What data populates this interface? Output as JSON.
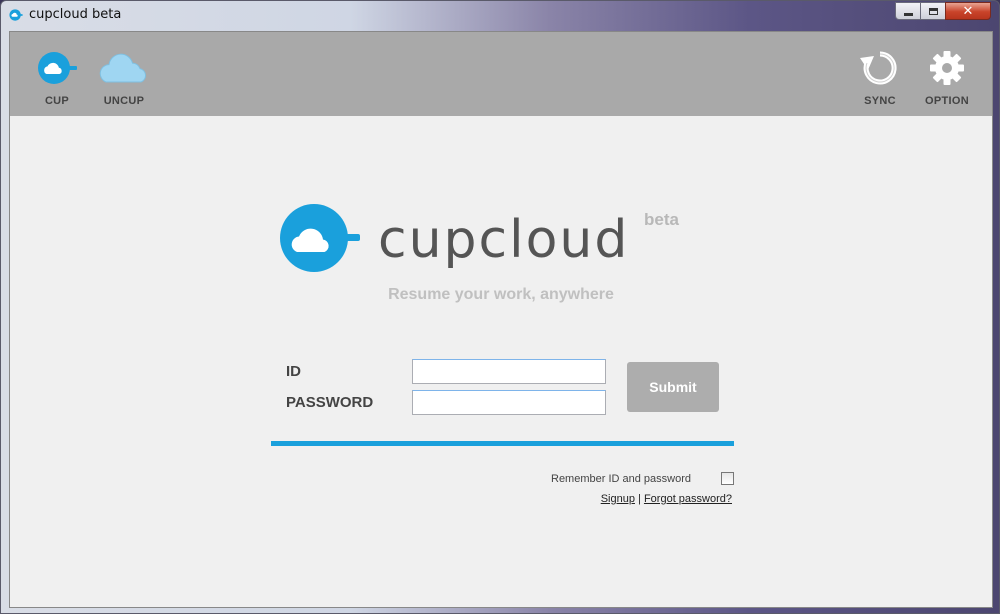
{
  "window": {
    "title": "cupcloud beta",
    "controls": {
      "minimize_icon": "minimize-icon",
      "maximize_icon": "maximize-icon",
      "close_glyph": "✕"
    }
  },
  "toolbar": {
    "left": [
      {
        "label": "CUP",
        "icon": "cup-cloud-icon",
        "color": "#1aa0dc"
      },
      {
        "label": "UNCUP",
        "icon": "cloud-icon",
        "color": "#9fd6f2"
      }
    ],
    "right": [
      {
        "label": "SYNC",
        "icon": "sync-icon"
      },
      {
        "label": "OPTION",
        "icon": "gear-icon"
      }
    ]
  },
  "branding": {
    "name": "cupcloud",
    "badge": "beta",
    "tagline": "Resume your work, anywhere",
    "accent_color": "#1aa0dc"
  },
  "login": {
    "id_label": "ID",
    "id_value": "",
    "password_label": "PASSWORD",
    "password_value": "",
    "submit_label": "Submit",
    "remember_label": "Remember ID and password",
    "remember_checked": false,
    "signup_link": "Signup",
    "separator": "|",
    "forgot_link": "Forgot password?"
  }
}
